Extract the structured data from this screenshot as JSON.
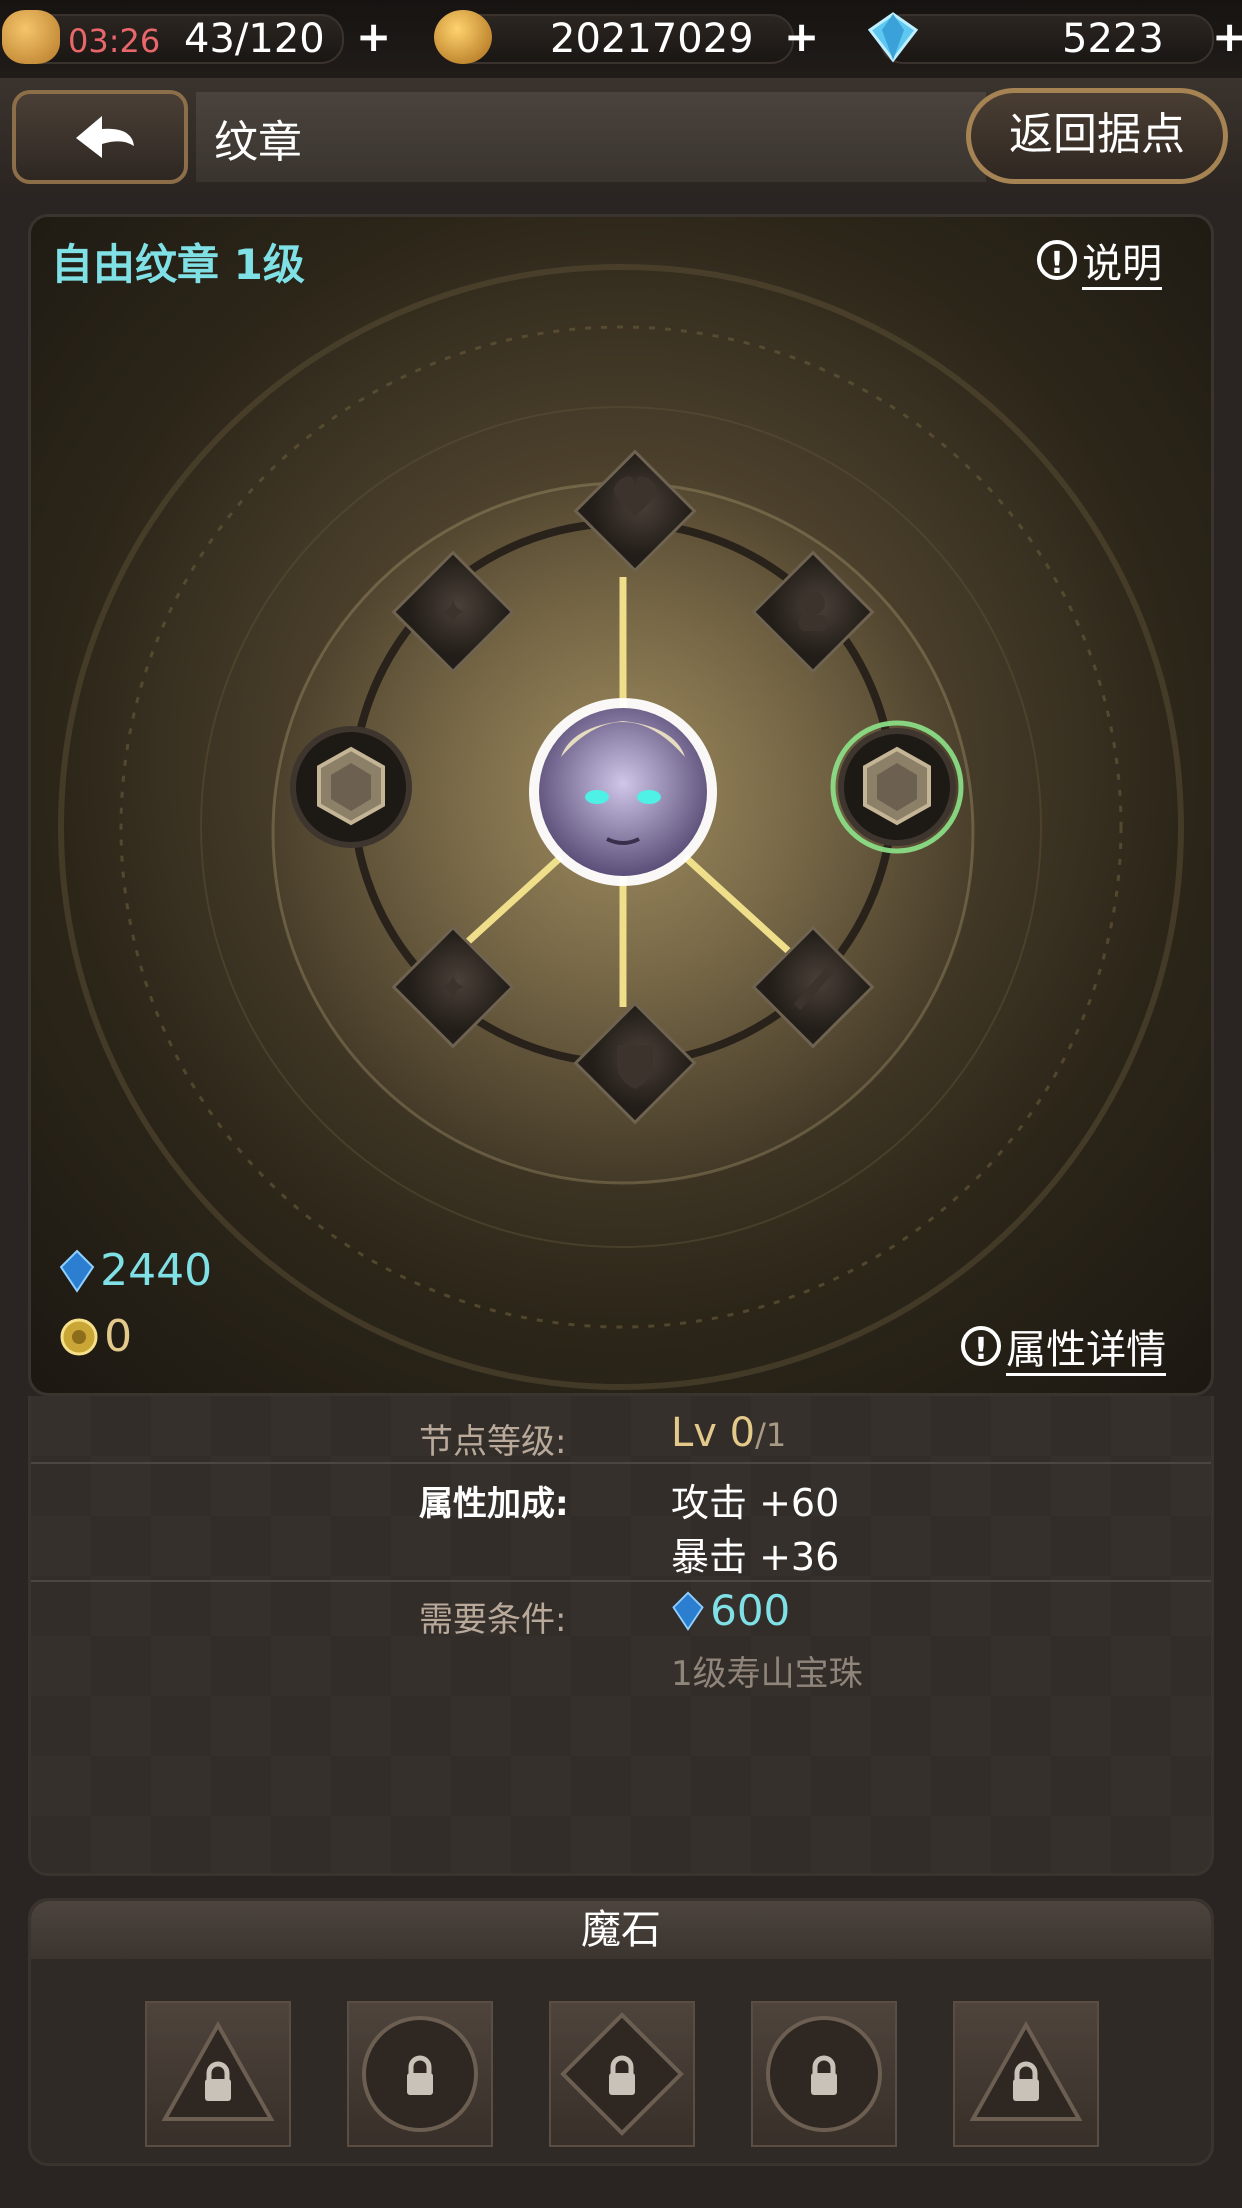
{
  "topbar": {
    "timer": "03:26",
    "stamina": "43/120",
    "gold": "20217029",
    "gems": "5223",
    "plus": "+"
  },
  "header": {
    "title": "纹章",
    "return_label": "返回据点"
  },
  "emblem": {
    "name": "自由纹章 1级",
    "help_label": "说明",
    "stat_details_label": "属性详情",
    "blue_crystal_count": "2440",
    "gold_medal_count": "0"
  },
  "details": {
    "node_level_label": "节点等级:",
    "node_level_prefix": "Lv 0",
    "node_level_max": "/1",
    "bonus_label": "属性加成:",
    "bonus_1": "攻击 +60",
    "bonus_2": "暴击 +36",
    "req_label": "需要条件:",
    "req_cost": "600",
    "req_item": "1级寿山宝珠"
  },
  "magic_stones": {
    "title": "魔石",
    "slots": [
      "triangle",
      "circle",
      "diamond",
      "circle",
      "triangle"
    ]
  },
  "colors": {
    "accent_cyan": "#7fe0e6",
    "gold": "#e3c98a",
    "line": "#f0df8a",
    "selected_glow": "#8de38a"
  }
}
